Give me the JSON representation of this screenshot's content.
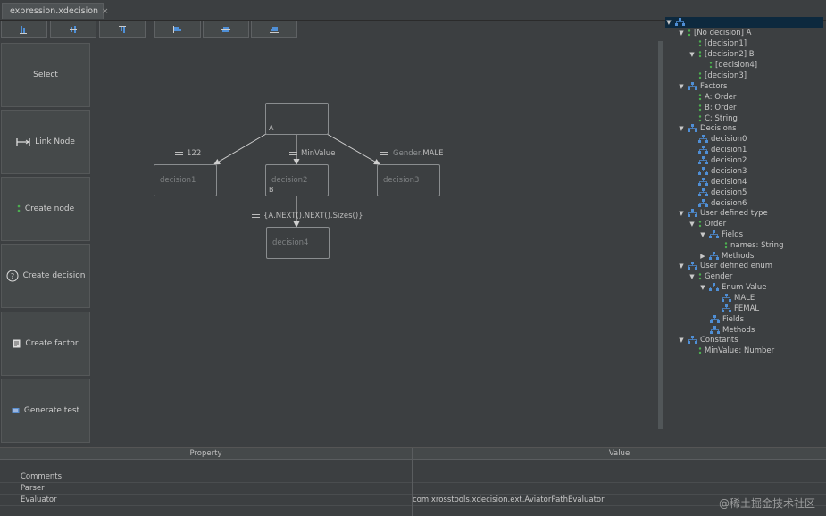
{
  "tab": {
    "title": "expression.xdecision",
    "close": "×"
  },
  "toolbar": {
    "buttons": [
      "align-left-icon",
      "align-center-icon",
      "align-right-icon",
      "align-top-icon",
      "align-middle-icon",
      "align-bottom-icon"
    ]
  },
  "palette": {
    "select": "Select",
    "link_node": "Link Node",
    "create_node": "Create node",
    "create_decision": "Create decision",
    "create_factor": "Create factor",
    "generate_test": "Generate test"
  },
  "diagram": {
    "nodes": {
      "root": {
        "label": "",
        "tag": "A"
      },
      "decision1": {
        "label": "decision1",
        "tag": ""
      },
      "decision2": {
        "label": "decision2",
        "tag": "B"
      },
      "decision3": {
        "label": "decision3",
        "tag": ""
      },
      "decision4": {
        "label": "decision4",
        "tag": ""
      }
    },
    "edges": {
      "e1": "122",
      "e2": "MinValue",
      "e3_prefix": "Gender.",
      "e3_suffix": "MALE",
      "e4": "{A.NEXT().NEXT().Sizes()}"
    }
  },
  "tree": {
    "root": "",
    "no_decision": "[No decision] A",
    "d1": "[decision1]",
    "d2": "[decision2] B",
    "d4": "[decision4]",
    "d3": "[decision3]",
    "factors": "Factors",
    "fA": "A: Order",
    "fB": "B: Order",
    "fC": "C: String",
    "decisions": "Decisions",
    "dec": [
      "decision0",
      "decision1",
      "decision2",
      "decision3",
      "decision4",
      "decision5",
      "decision6"
    ],
    "udt": "User defined type",
    "order": "Order",
    "fields": "Fields",
    "names": "names: String",
    "methods": "Methods",
    "ude": "User defined enum",
    "gender": "Gender",
    "enum_value": "Enum Value",
    "male": "MALE",
    "femal": "FEMAL",
    "fields2": "Fields",
    "methods2": "Methods",
    "constants": "Constants",
    "minvalue": "MinValue: Number"
  },
  "properties": {
    "header_property": "Property",
    "header_value": "Value",
    "rows": [
      {
        "key": "Comments",
        "value": ""
      },
      {
        "key": "Parser",
        "value": ""
      },
      {
        "key": "Evaluator",
        "value": "com.xrosstools.xdecision.ext.AviatorPathEvaluator"
      }
    ]
  },
  "watermark": "@稀土掘金技术社区",
  "colors": {
    "background": "#3c3f41",
    "selection": "#0d293e",
    "tree_icon": "#4f8fd6",
    "node_icon": "#4caf50"
  }
}
